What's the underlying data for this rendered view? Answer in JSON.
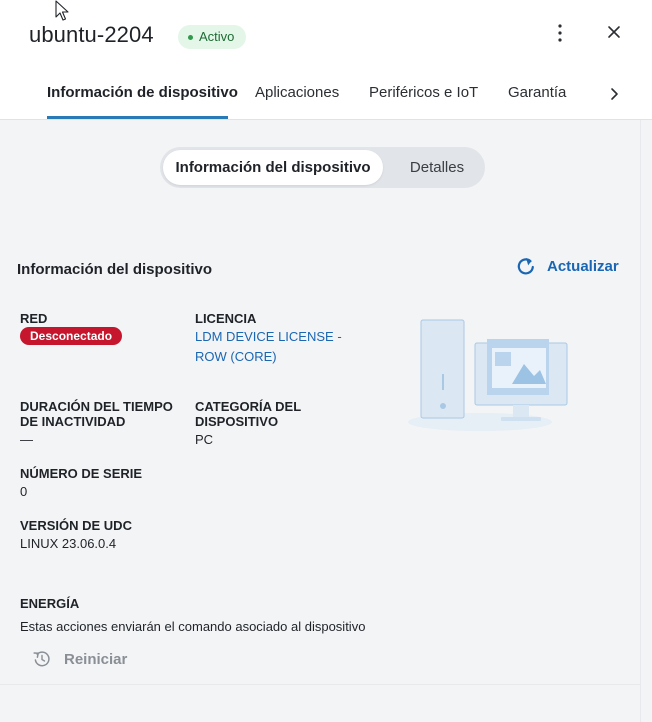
{
  "header": {
    "title": "ubuntu-2204",
    "status": "Activo"
  },
  "tabs": [
    {
      "label": "Información de dispositivo"
    },
    {
      "label": "Aplicaciones"
    },
    {
      "label": "Periféricos e IoT"
    },
    {
      "label": "Garantía"
    }
  ],
  "segmented": {
    "active": "Información del dispositivo",
    "inactive": "Detalles"
  },
  "section": {
    "title": "Información del dispositivo",
    "refresh_label": "Actualizar"
  },
  "fields": {
    "network_label": "RED",
    "network_value": "Desconectado",
    "license_label": "LICENCIA",
    "license_value_line1": "LDM DEVICE LICENSE -",
    "license_value_line2": "ROW (CORE)",
    "idle_label_line1": "DURACIÓN DEL TIEMPO",
    "idle_label_line2": "DE INACTIVIDAD",
    "idle_value": "—",
    "category_label_line1": "CATEGORÍA DEL",
    "category_label_line2": "DISPOSITIVO",
    "category_value": "PC",
    "serial_label": "NÚMERO DE SERIE",
    "serial_value": "0",
    "udc_label": "VERSIÓN DE UDC",
    "udc_value": "LINUX 23.06.0.4"
  },
  "energy": {
    "title": "ENERGÍA",
    "description": "Estas acciones enviarán el comando asociado al dispositivo",
    "restart_label": "Reiniciar"
  },
  "icons": {
    "cursor": "mouse-pointer-icon",
    "more": "kebab-menu-icon",
    "close": "close-icon",
    "next": "chevron-right-icon",
    "refresh": "refresh-icon",
    "restart": "restart-icon",
    "illustration": "desktop-computer-illustration"
  },
  "colors": {
    "accent": "#1a66b3",
    "tab_underline": "#2a7ab8",
    "active_badge_bg": "#e3f6e8",
    "active_badge_text": "#1d6b34",
    "disconnected_bg": "#c5162e"
  }
}
